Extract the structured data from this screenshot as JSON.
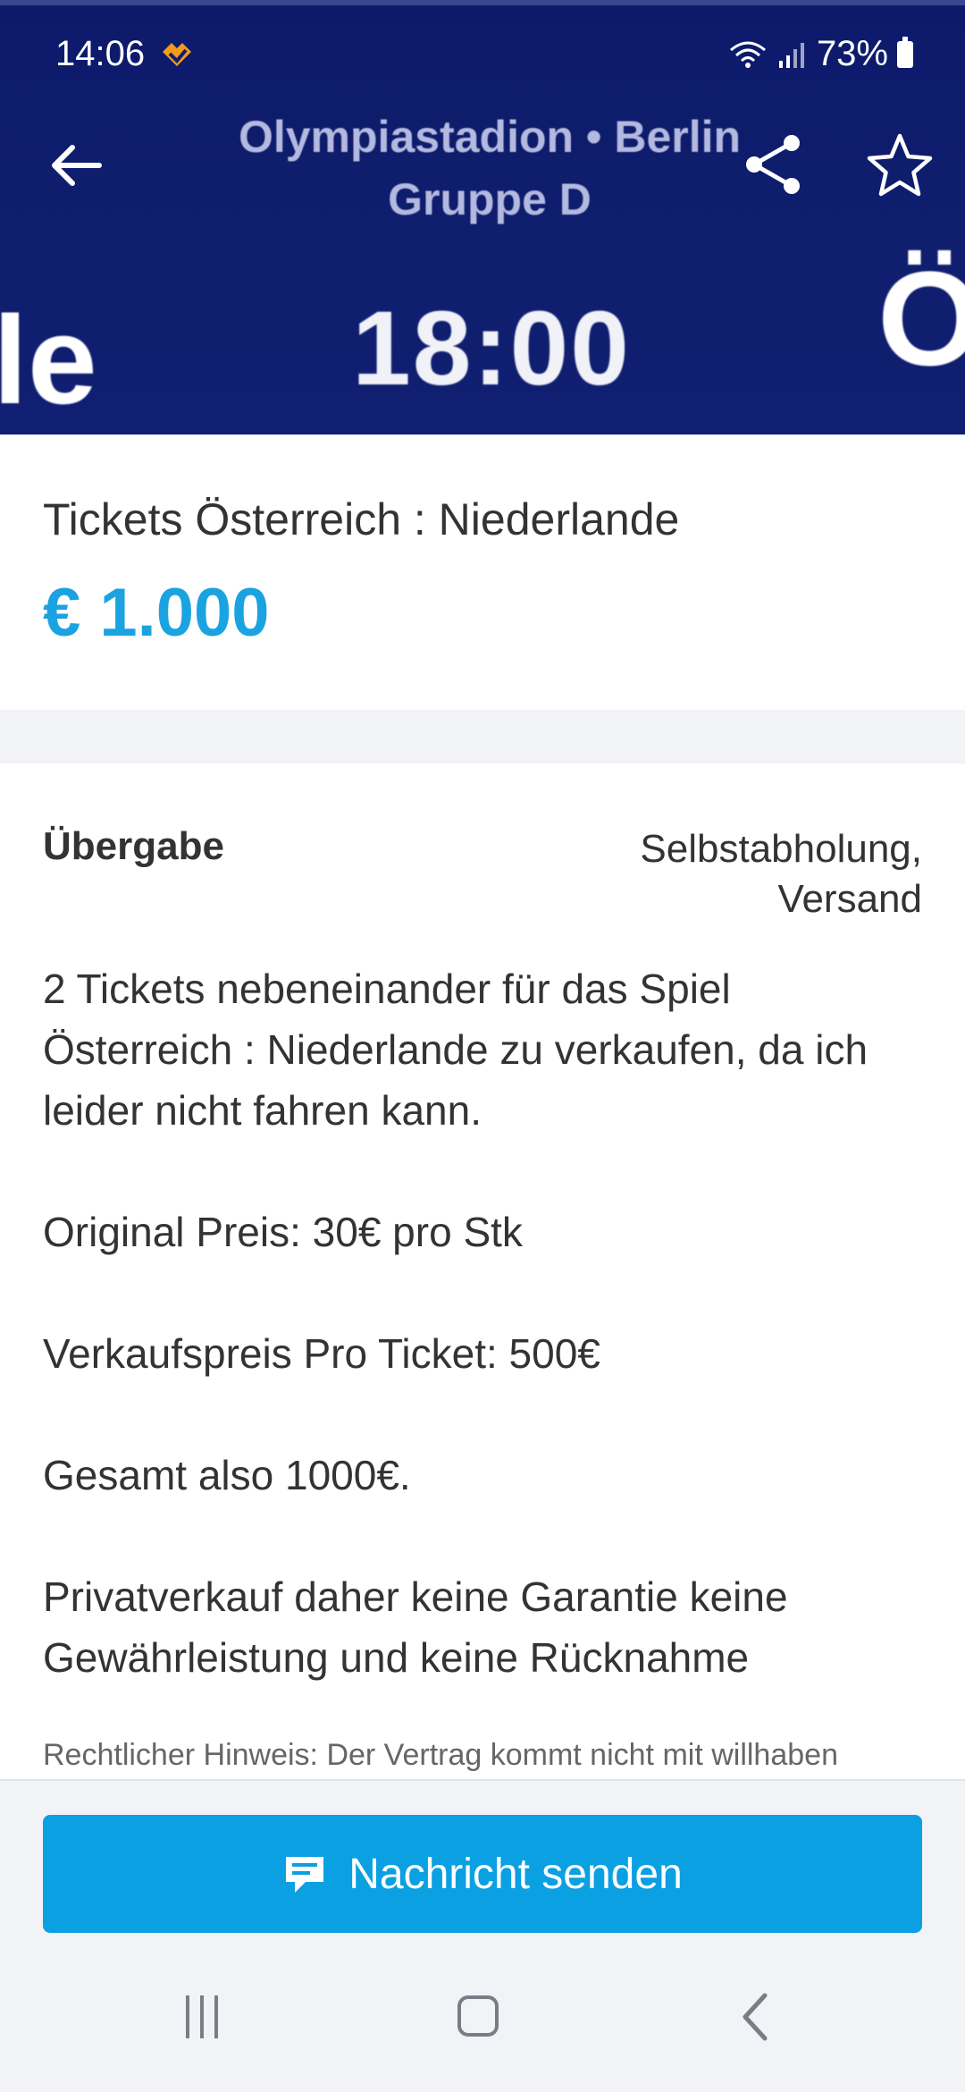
{
  "status_bar": {
    "time": "14:06",
    "battery": "73%"
  },
  "hero": {
    "venue_line1": "Olympiastadion • Berlin",
    "venue_line2": "Gruppe D",
    "kickoff": "18:00",
    "left_fragment": "le",
    "right_fragment": "Ö",
    "bg_color": "#0f1d6d"
  },
  "toolbar": {
    "back_icon": "arrow-left-icon",
    "share_icon": "share-icon",
    "favorite_icon": "star-outline-icon"
  },
  "listing": {
    "title": "Tickets Österreich : Niederlande",
    "price": "€ 1.000",
    "price_color": "#1aa3e0"
  },
  "details": {
    "handover_label": "Übergabe",
    "handover_value_line1": "Selbstabholung,",
    "handover_value_line2": "Versand",
    "description": [
      "2 Tickets nebeneinander für das Spiel Österreich : Niederlande zu verkaufen, da ich leider nicht fahren kann.",
      "Original Preis: 30€ pro Stk",
      "Verkaufspreis Pro Ticket: 500€",
      "Gesamt also 1000€.",
      "Privatverkauf daher keine Garantie keine Gewährleistung und keine Rücknahme"
    ],
    "legal_notice": "Rechtlicher Hinweis: Der Vertrag kommt nicht mit willhaben"
  },
  "actions": {
    "send_message_label": "Nachricht senden",
    "send_message_icon": "chat-message-icon",
    "button_color": "#0aa0e2"
  },
  "navigation": {
    "recent_icon": "recent-apps-icon",
    "home_icon": "home-icon",
    "back_icon": "nav-back-icon"
  }
}
